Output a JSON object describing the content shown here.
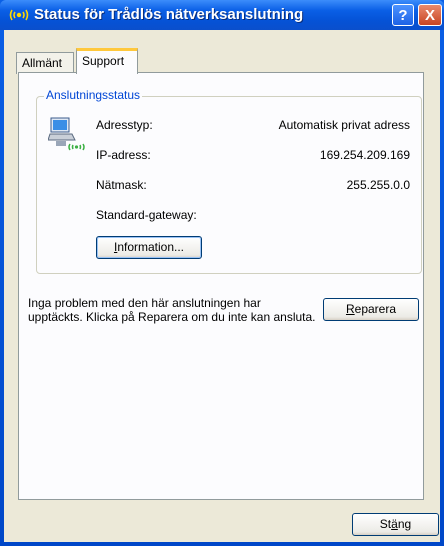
{
  "window": {
    "title": "Status för Trådlös nätverksanslutning",
    "help_glyph": "?",
    "close_glyph": "X"
  },
  "tabs": [
    {
      "label": "Allmänt",
      "selected": false
    },
    {
      "label": "Support",
      "selected": true
    }
  ],
  "connection_status": {
    "group_label": "Anslutningsstatus",
    "rows": [
      {
        "label": "Adresstyp:",
        "value": "Automatisk privat adress"
      },
      {
        "label": "IP-adress:",
        "value": "169.254.209.169"
      },
      {
        "label": "Nätmask:",
        "value": "255.255.0.0"
      },
      {
        "label": "Standard-gateway:",
        "value": ""
      }
    ],
    "details_button": {
      "pre": "",
      "accel": "I",
      "post": "nformation..."
    }
  },
  "repair": {
    "message": "Inga problem med den här anslutningen har upptäckts. Klicka på Reparera om du inte kan ansluta.",
    "button": {
      "pre": "",
      "accel": "R",
      "post": "eparera"
    }
  },
  "footer": {
    "close_button": {
      "pre": "St",
      "accel": "ä",
      "post": "ng"
    }
  },
  "colors": {
    "title_blue": "#0a5fe6",
    "dialog_face": "#ece9d8",
    "legend_text": "#0046d5",
    "close_red": "#c84422"
  },
  "icons": {
    "title": "wireless-network-icon",
    "connection": "network-computer-icon"
  }
}
